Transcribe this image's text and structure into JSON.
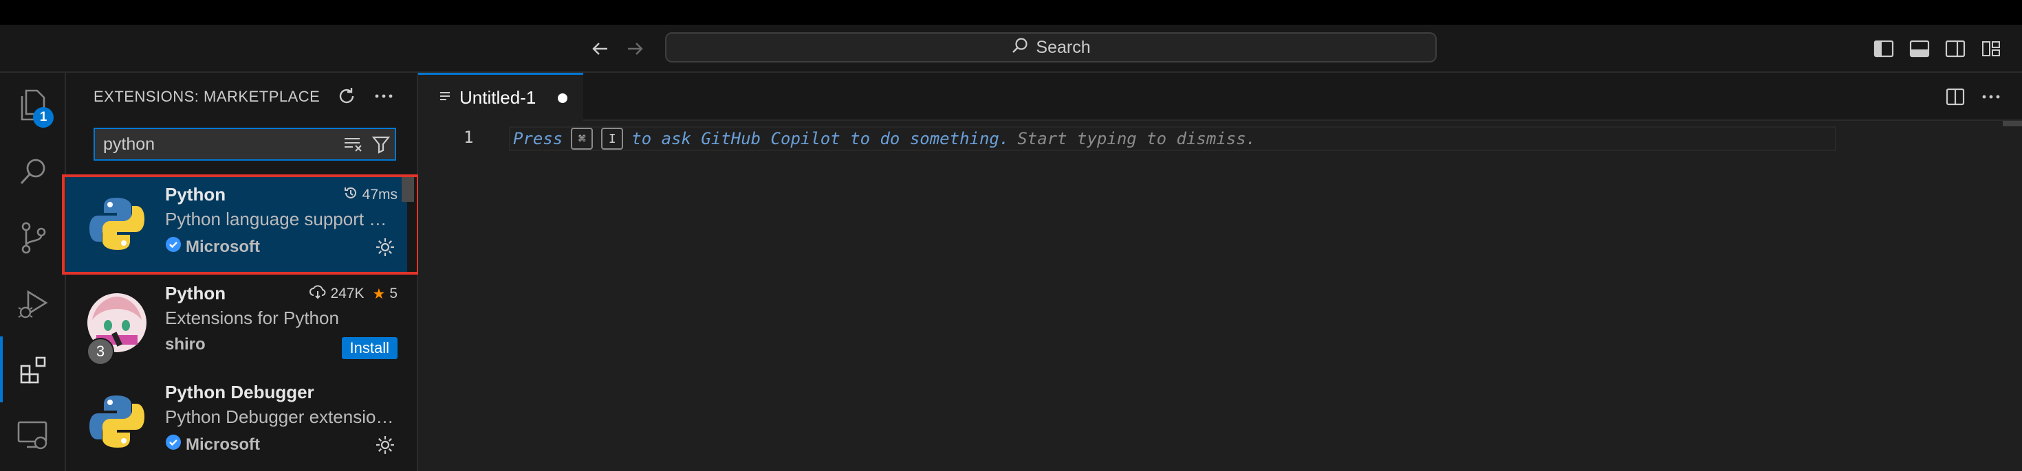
{
  "titlebar": {
    "search_label": "Search"
  },
  "activity_bar": {
    "explorer_badge": "1"
  },
  "sidebar": {
    "title": "EXTENSIONS: MARKETPLACE",
    "search_value": "python",
    "extensions": [
      {
        "name": "Python",
        "description": "Python language support with extended features",
        "publisher": "Microsoft",
        "verified": true,
        "meta": "47ms",
        "meta_icon": "history-icon",
        "action": "gear-icon"
      },
      {
        "name": "Python",
        "description": "Extensions for Python",
        "publisher": "shiro",
        "verified": false,
        "downloads": "247K",
        "rating": "5",
        "action_label": "Install",
        "badge": "3"
      },
      {
        "name": "Python Debugger",
        "description": "Python Debugger extension using debugpy",
        "publisher": "Microsoft",
        "verified": true,
        "action": "gear-icon"
      }
    ]
  },
  "editor": {
    "tab_label": "Untitled-1",
    "line_number": "1",
    "hint_press": "Press",
    "hint_key1": "⌘",
    "hint_key2": "I",
    "hint_ask": "to ask GitHub Copilot to do something.",
    "hint_dismiss": "Start typing to dismiss."
  },
  "colors": {
    "accent": "#0078d4",
    "highlight": "#e0342b",
    "hint_text": "#6a9fd8"
  }
}
